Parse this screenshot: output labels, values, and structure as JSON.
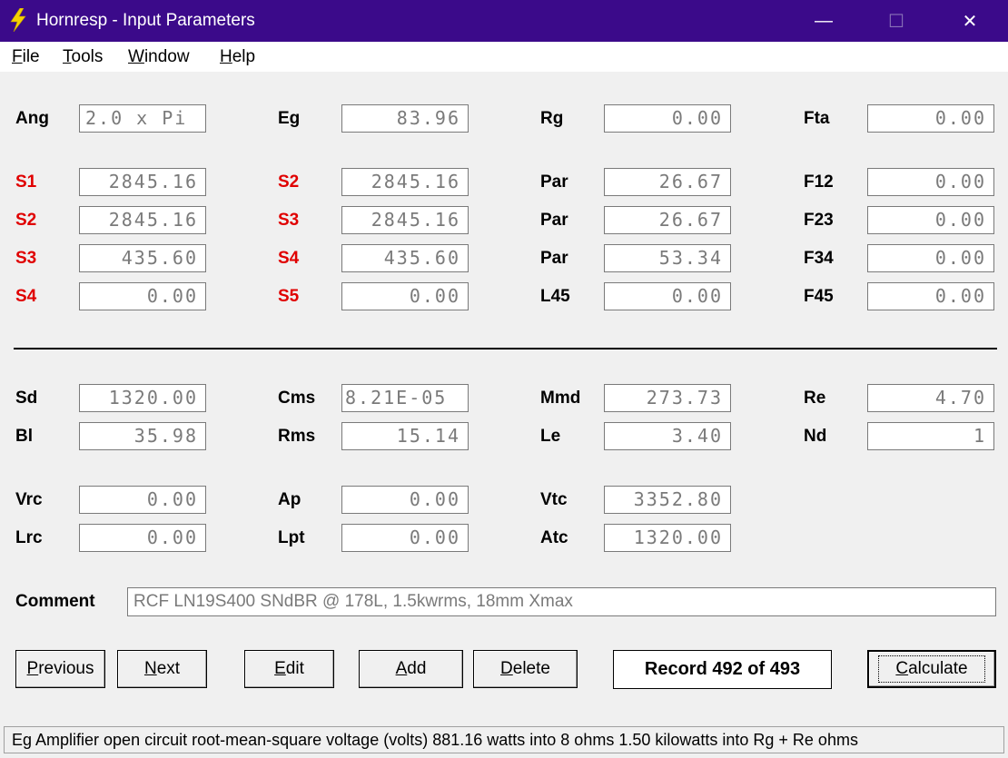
{
  "window": {
    "title": "Hornresp - Input Parameters",
    "minimize_glyph": "—",
    "maximize_glyph": "☐",
    "close_glyph": "✕",
    "icon": "lightning-icon",
    "icon_color": "#f5d000"
  },
  "menu": {
    "file_hot": "F",
    "file_rest": "ile",
    "tools_hot": "T",
    "tools_rest": "ools",
    "window_hot": "W",
    "window_rest": "indow",
    "help_hot": "H",
    "help_rest": "elp"
  },
  "top": {
    "ang_label": "Ang",
    "ang_value": "2.0 x Pi",
    "eg_label": "Eg",
    "eg_value": "83.96",
    "rg_label": "Rg",
    "rg_value": "0.00",
    "fta_label": "Fta",
    "fta_value": "0.00"
  },
  "horn_rows": [
    {
      "a_label": "S1",
      "a_value": "2845.16",
      "b_label": "S2",
      "b_value": "2845.16",
      "c_label": "Par",
      "c_value": "26.67",
      "d_label": "F12",
      "d_value": "0.00"
    },
    {
      "a_label": "S2",
      "a_value": "2845.16",
      "b_label": "S3",
      "b_value": "2845.16",
      "c_label": "Par",
      "c_value": "26.67",
      "d_label": "F23",
      "d_value": "0.00"
    },
    {
      "a_label": "S3",
      "a_value": "435.60",
      "b_label": "S4",
      "b_value": "435.60",
      "c_label": "Par",
      "c_value": "53.34",
      "d_label": "F34",
      "d_value": "0.00"
    },
    {
      "a_label": "S4",
      "a_value": "0.00",
      "b_label": "S5",
      "b_value": "0.00",
      "c_label": "L45",
      "c_value": "0.00",
      "d_label": "F45",
      "d_value": "0.00"
    }
  ],
  "driver": {
    "sd_label": "Sd",
    "sd_value": "1320.00",
    "cms_label": "Cms",
    "cms_value": "8.21E-05",
    "mmd_label": "Mmd",
    "mmd_value": "273.73",
    "re_label": "Re",
    "re_value": "4.70",
    "bl_label": "Bl",
    "bl_value": "35.98",
    "rms_label": "Rms",
    "rms_value": "15.14",
    "le_label": "Le",
    "le_value": "3.40",
    "nd_label": "Nd",
    "nd_value": "1"
  },
  "chambers": {
    "vrc_label": "Vrc",
    "vrc_value": "0.00",
    "ap_label": "Ap",
    "ap_value": "0.00",
    "vtc_label": "Vtc",
    "vtc_value": "3352.80",
    "lrc_label": "Lrc",
    "lrc_value": "0.00",
    "lpt_label": "Lpt",
    "lpt_value": "0.00",
    "atc_label": "Atc",
    "atc_value": "1320.00"
  },
  "comment": {
    "label": "Comment",
    "value": "RCF LN19S400 SNdBR @ 178L, 1.5kwrms, 18mm Xmax"
  },
  "buttons": {
    "previous_hot": "P",
    "previous_rest": "revious",
    "next_hot": "N",
    "next_rest": "ext",
    "edit_hot": "E",
    "edit_rest": "dit",
    "add_hot": "A",
    "add_rest": "dd",
    "delete_hot": "D",
    "delete_rest": "elete",
    "calculate_hot": "C",
    "calculate_rest": "alculate"
  },
  "record": "Record 492 of 493",
  "status": "Eg  Amplifier open circuit root-mean-square voltage  (volts)  881.16 watts into 8 ohms   1.50 kilowatts into Rg + Re ohms",
  "colors": {
    "titlebar": "#3b0a8a",
    "red_label": "#e00000",
    "field_text": "#7a7a7a"
  }
}
